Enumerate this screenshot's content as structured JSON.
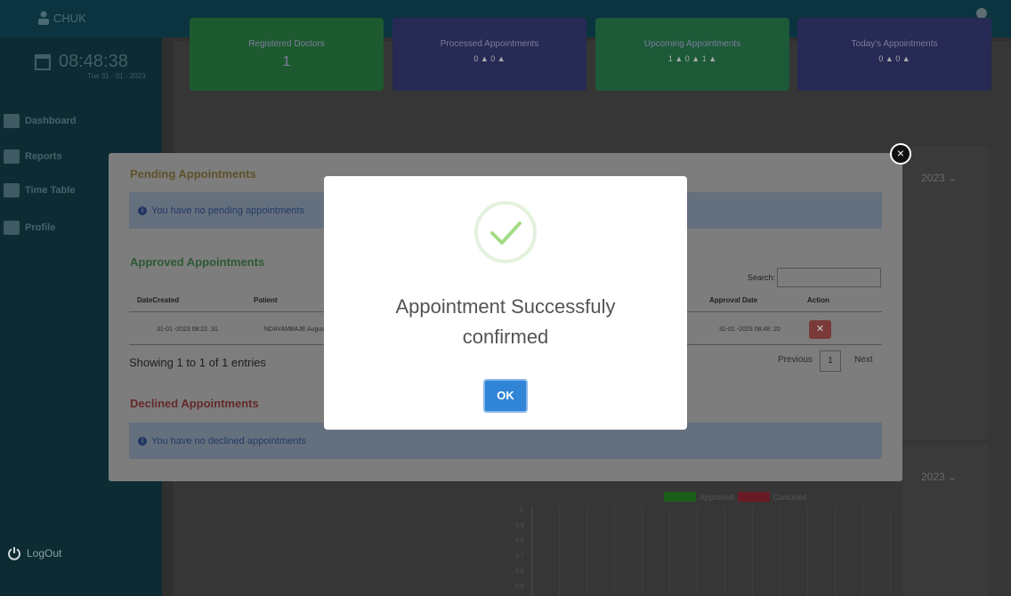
{
  "app": {
    "brand": "CHUK",
    "clock_time": "08:48:38",
    "clock_date": "Tue 31 - 01 - 2023"
  },
  "sidebar": {
    "items": [
      {
        "label": "Dashboard",
        "icon": "dashboard-icon"
      },
      {
        "label": "Reports",
        "icon": "reports-icon"
      },
      {
        "label": "Time Table",
        "icon": "calendar-icon"
      },
      {
        "label": "Profile",
        "icon": "profile-icon"
      }
    ],
    "logout": "LogOut"
  },
  "cards": [
    {
      "label": "Registered Doctors",
      "value": "1",
      "color": "#1d5a2f"
    },
    {
      "label": "Processed Appointments",
      "value": "",
      "color": "#262a55"
    },
    {
      "label": "Upcoming Appointments",
      "value": "",
      "color": "#1c5a38"
    },
    {
      "label": "Today's Appointments",
      "value": "",
      "color": "#262a55"
    }
  ],
  "card_counts": {
    "processed": [
      "0",
      "0"
    ],
    "upcoming": [
      "1",
      "0",
      "1"
    ],
    "today": [
      "0",
      "0"
    ]
  },
  "year_select": "2023",
  "chart_legend": {
    "approved": "Approved",
    "canceled": "Canceled",
    "approved_color": "#1a5e1a",
    "canceled_color": "#6a1a24"
  },
  "chart_ticks": [
    "1",
    "0.9",
    "0.8",
    "0.7",
    "0.6",
    "0.5"
  ],
  "modal": {
    "pending_title": "Pending Appointments",
    "pending_alert": "You have no pending appointments",
    "approved_title": "Approved Appointments",
    "search_label": "Search:",
    "columns": [
      "DateCreated",
      "Patient",
      "Approval Date",
      "Action"
    ],
    "row": {
      "date_created": "31-01 -2023 08:22 :31",
      "patient": "NDAYAMBAJE August",
      "approval_date": "31-01 -2023 08:48 :20"
    },
    "showing": "Showing 1 to 1 of 1 entries",
    "pager_prev": "Previous",
    "pager_page": "1",
    "pager_next": "Next",
    "declined_title": "Declined Appointments",
    "declined_alert": "You have no declined appointments"
  },
  "dialog": {
    "title_line1": "Appointment Successfuly",
    "title_line2": "confirmed",
    "ok_label": "OK",
    "accent_color": "#3085d6",
    "success_color": "#a5dc86"
  }
}
